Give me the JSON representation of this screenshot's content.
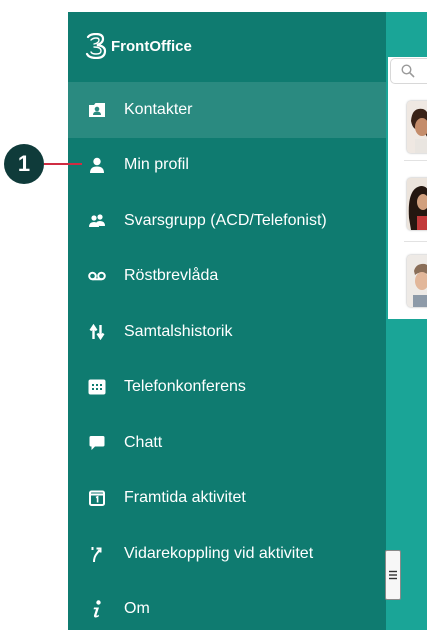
{
  "app": {
    "brand_name": "FrontOffice"
  },
  "menu": {
    "items": [
      {
        "label": "Kontakter",
        "icon": "contacts-icon",
        "active": true
      },
      {
        "label": "Min profil",
        "icon": "person-icon"
      },
      {
        "label": "Svarsgrupp (ACD/Telefonist)",
        "icon": "group-icon"
      },
      {
        "label": "Röstbrevlåda",
        "icon": "voicemail-icon"
      },
      {
        "label": "Samtalshistorik",
        "icon": "swap-arrows-icon"
      },
      {
        "label": "Telefonkonferens",
        "icon": "dialpad-icon"
      },
      {
        "label": "Chatt",
        "icon": "chat-bubble-icon"
      },
      {
        "label": "Framtida aktivitet",
        "icon": "calendar-icon"
      },
      {
        "label": "Vidarekoppling vid aktivitet",
        "icon": "call-forward-icon"
      },
      {
        "label": "Om",
        "icon": "info-icon"
      }
    ]
  },
  "callout": {
    "number": "1"
  },
  "colors": {
    "drawer": "#0f7b70",
    "drawer_active": "#2a8a80",
    "background_teal": "#1aa597",
    "callout": "#0f3b3a",
    "callout_line": "#cf2c42"
  }
}
